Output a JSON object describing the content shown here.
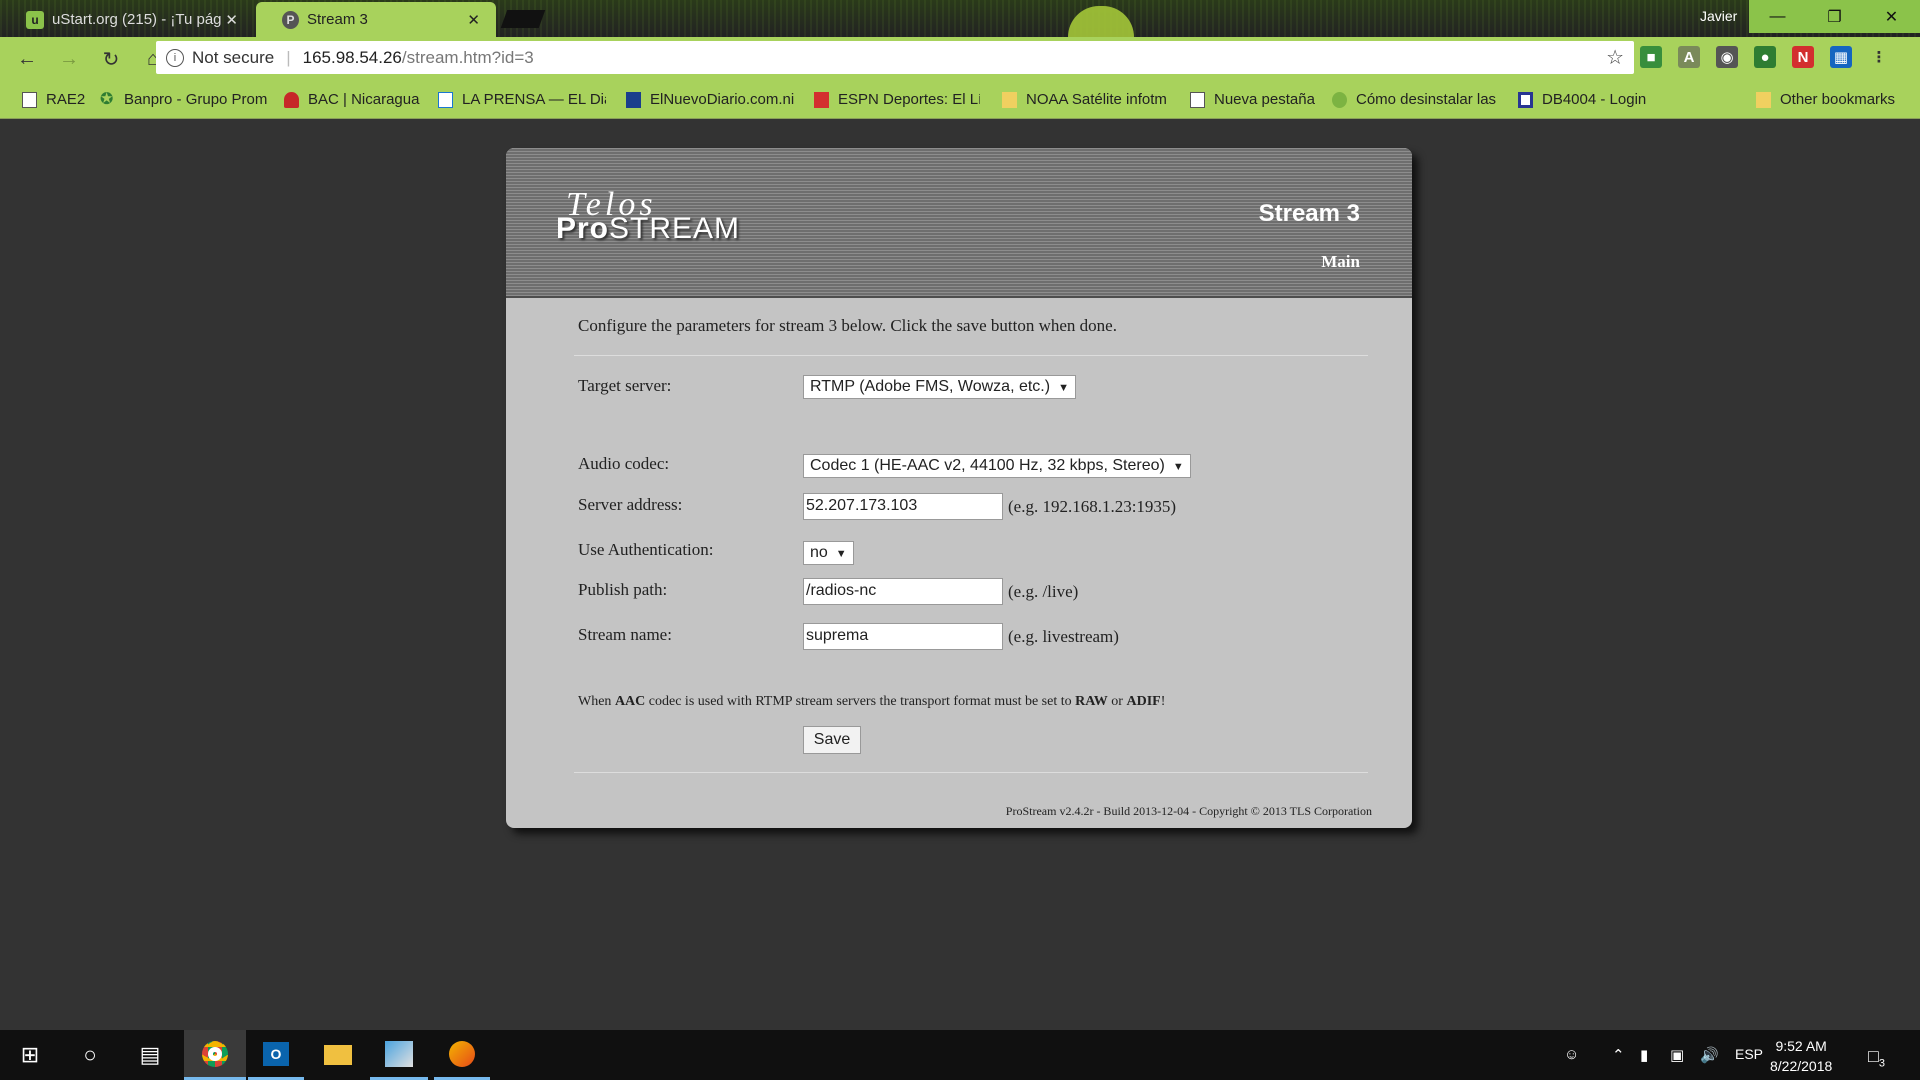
{
  "browser": {
    "tabs": [
      {
        "title": "uStart.org (215) - ¡Tu pág",
        "favicon": "u"
      },
      {
        "title": "Stream 3",
        "favicon": "P"
      }
    ],
    "user": "Javier",
    "address": {
      "security": "Not secure",
      "host": "165.98.54.26",
      "path": "/stream.htm?id=3"
    },
    "bookmarks": [
      {
        "label": "RAE2",
        "color": "#555"
      },
      {
        "label": "Banpro - Grupo Prom",
        "color": "#2e7d32"
      },
      {
        "label": "BAC | Nicaragua",
        "color": "#c62828"
      },
      {
        "label": "LA PRENSA — EL Dia",
        "color": "#1976d2"
      },
      {
        "label": "ElNuevoDiario.com.ni",
        "color": "#1a3e8c"
      },
      {
        "label": "ESPN Deportes: El Líd",
        "color": "#d32f2f"
      },
      {
        "label": "NOAA Satélite infotm",
        "color": "#f0d060"
      },
      {
        "label": "Nueva pestaña",
        "color": "#555"
      },
      {
        "label": "Cómo desinstalar las",
        "color": "#7cb342"
      },
      {
        "label": "DB4004 - Login",
        "color": "#283593"
      },
      {
        "label": "Other bookmarks",
        "color": "#f0d060"
      }
    ]
  },
  "page": {
    "title": "Stream 3",
    "main_link": "Main",
    "logo_script": "Telos",
    "logo_pro": "Pro",
    "logo_stream": "STREAM",
    "intro": "Configure the parameters for stream 3 below. Click the save button when done.",
    "fields": {
      "target_server": {
        "label": "Target server:",
        "value": "RTMP (Adobe FMS, Wowza, etc.)"
      },
      "audio_codec": {
        "label": "Audio codec:",
        "value": "Codec 1 (HE-AAC v2, 44100 Hz, 32 kbps, Stereo)"
      },
      "server_address": {
        "label": "Server address:",
        "value": "52.207.173.103",
        "hint": "(e.g. 192.168.1.23:1935)"
      },
      "use_auth": {
        "label": "Use Authentication:",
        "value": "no"
      },
      "publish_path": {
        "label": "Publish path:",
        "value": "/radios-nc",
        "hint": "(e.g. /live)"
      },
      "stream_name": {
        "label": "Stream name:",
        "value": "suprema",
        "hint": "(e.g. livestream)"
      }
    },
    "note": {
      "p1": "When ",
      "b1": "AAC",
      "p2": " codec is used with RTMP stream servers the transport format must be set to ",
      "b2": "RAW",
      "p3": " or ",
      "b3": "ADIF",
      "p4": "!"
    },
    "save_label": "Save",
    "footer": "ProStream v2.4.2r - Build 2013-12-04 - Copyright © 2013 TLS Corporation"
  },
  "taskbar": {
    "language": "ESP",
    "time": "9:52 AM",
    "date": "8/22/2018",
    "notifications": "3"
  },
  "colors": {
    "chrome_green": "#a8d25c",
    "panel_gray": "#c4c4c4",
    "taskbar": "#101010"
  }
}
